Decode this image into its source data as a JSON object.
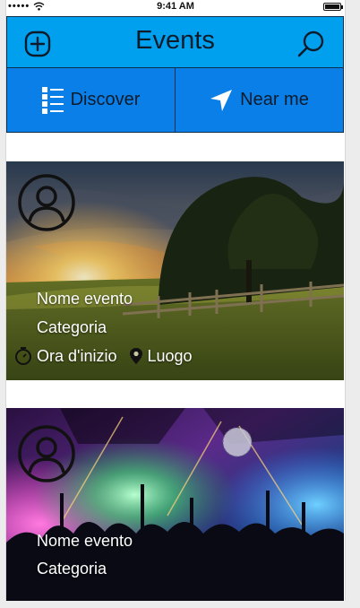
{
  "status_bar": {
    "signal": "•••••",
    "time": "9:41 AM"
  },
  "header": {
    "title": "Events",
    "add_icon": "plus-circle-icon",
    "search_icon": "search-icon"
  },
  "tabs": [
    {
      "label": "Discover",
      "icon": "list-icon"
    },
    {
      "label": "Near me",
      "icon": "navigation-arrow-icon"
    }
  ],
  "events": [
    {
      "name": "Nome evento",
      "category": "Categoria",
      "start_time": "Ora d'inizio",
      "location": "Luogo",
      "image": "sunset-meadow-photo"
    },
    {
      "name": "Nome evento",
      "category": "Categoria",
      "image": "concert-crowd-photo"
    }
  ],
  "colors": {
    "header_bg": "#00a0ee",
    "tabs_bg": "#0a7fe8"
  }
}
